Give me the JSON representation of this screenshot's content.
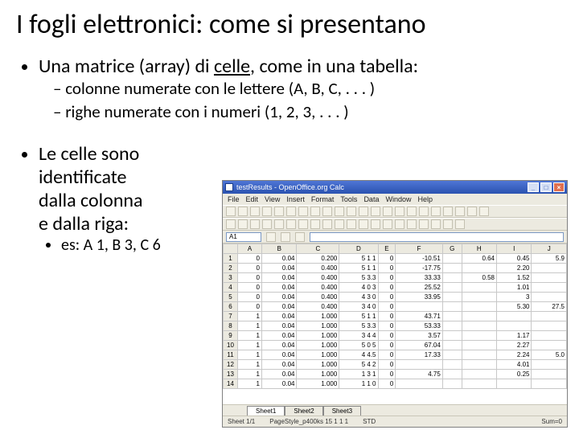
{
  "title": "I fogli elettronici: come si presentano",
  "b1": "Una matrice (array) di ",
  "b1_underlined": "celle",
  "b1_tail": ", come in una tabella:",
  "b1a": "colonne numerate con le lettere (A, B, C, . . . )",
  "b1b": "righe numerate con i numeri (1, 2, 3, . . . )",
  "b2_l1": "Le celle sono",
  "b2_l2": "identificate",
  "b2_l3": "dalla colonna",
  "b2_l4": "e dalla riga:",
  "b2a": "es: A 1, B 3, C 6",
  "app": {
    "title": "testResults - OpenOffice.org Calc",
    "menus": [
      "File",
      "Edit",
      "View",
      "Insert",
      "Format",
      "Tools",
      "Data",
      "Window",
      "Help"
    ],
    "namebox": "A1",
    "cols": [
      "A",
      "B",
      "C",
      "D",
      "E",
      "F",
      "G",
      "H",
      "I",
      "J"
    ],
    "rows": [
      [
        "0",
        "0.04",
        "0.200",
        "5 1 1",
        "0",
        "-10.51",
        "",
        "0.64",
        "0.45",
        "5.9"
      ],
      [
        "0",
        "0.04",
        "0.400",
        "5 1 1",
        "0",
        "-17.75",
        "",
        "",
        "2.20",
        ""
      ],
      [
        "0",
        "0.04",
        "0.400",
        "5 3.3",
        "0",
        "33.33",
        "",
        "0.58",
        "1.52",
        ""
      ],
      [
        "0",
        "0.04",
        "0.400",
        "4 0 3",
        "0",
        "25.52",
        "",
        "",
        "1.01",
        ""
      ],
      [
        "0",
        "0.04",
        "0.400",
        "4 3 0",
        "0",
        "33.95",
        "",
        "",
        "3",
        ""
      ],
      [
        "0",
        "0.04",
        "0.400",
        "3 4 0",
        "0",
        "",
        "",
        "",
        "5.30",
        "27.5"
      ],
      [
        "1",
        "0.04",
        "1.000",
        "5 1 1",
        "0",
        "43.71",
        "",
        "",
        "",
        ""
      ],
      [
        "1",
        "0.04",
        "1.000",
        "5 3.3",
        "0",
        "53.33",
        "",
        "",
        "",
        ""
      ],
      [
        "1",
        "0.04",
        "1.000",
        "3 4 4",
        "0",
        "3.57",
        "",
        "",
        "1.17",
        ""
      ],
      [
        "1",
        "0.04",
        "1.000",
        "5 0 5",
        "0",
        "67.04",
        "",
        "",
        "2.27",
        ""
      ],
      [
        "1",
        "0.04",
        "1.000",
        "4 4.5",
        "0",
        "17.33",
        "",
        "",
        "2.24",
        "5.0"
      ],
      [
        "1",
        "0.04",
        "1.000",
        "5 4 2",
        "0",
        "",
        "",
        "",
        "4.01",
        ""
      ],
      [
        "1",
        "0.04",
        "1.000",
        "1 3 1",
        "0",
        "4.75",
        "",
        "",
        "0.25",
        ""
      ],
      [
        "1",
        "0.04",
        "1.000",
        "1 1 0",
        "0",
        "",
        "",
        "",
        "",
        ""
      ]
    ],
    "tabs": [
      "Sheet1",
      "Sheet2",
      "Sheet3"
    ],
    "status": {
      "sheet": "Sheet 1/1",
      "mode": "PageStyle_p400ks 15 1 1 1",
      "std": "STD",
      "sum": "Sum=0"
    }
  }
}
